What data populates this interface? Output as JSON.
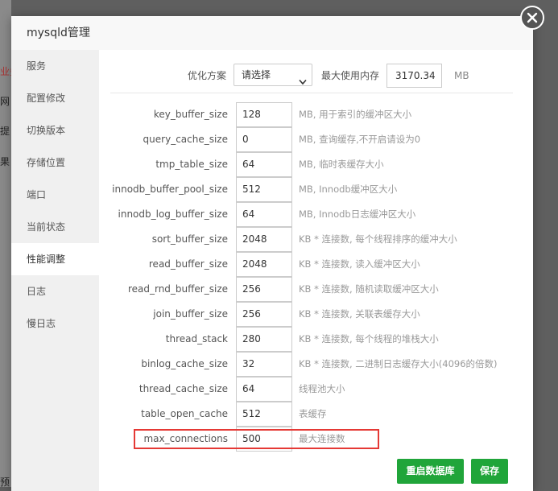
{
  "background": {
    "fragments": [
      "业务",
      "网",
      "提",
      "果",
      "预"
    ]
  },
  "dialog": {
    "title": "mysqld管理",
    "close_icon": "close-icon"
  },
  "sidebar": {
    "items": [
      {
        "label": "服务",
        "active": false
      },
      {
        "label": "配置修改",
        "active": false
      },
      {
        "label": "切换版本",
        "active": false
      },
      {
        "label": "存储位置",
        "active": false
      },
      {
        "label": "端口",
        "active": false
      },
      {
        "label": "当前状态",
        "active": false
      },
      {
        "label": "性能调整",
        "active": true
      },
      {
        "label": "日志",
        "active": false
      },
      {
        "label": "慢日志",
        "active": false
      }
    ]
  },
  "optimize": {
    "label": "优化方案",
    "select_value": "请选择",
    "max_mem_label": "最大使用内存",
    "max_mem_value": "3170.34",
    "max_mem_unit": "MB"
  },
  "params": [
    {
      "name": "key_buffer_size",
      "value": "128",
      "desc": "MB, 用于索引的缓冲区大小"
    },
    {
      "name": "query_cache_size",
      "value": "0",
      "desc": "MB, 查询缓存,不开启请设为0"
    },
    {
      "name": "tmp_table_size",
      "value": "64",
      "desc": "MB, 临时表缓存大小"
    },
    {
      "name": "innodb_buffer_pool_size",
      "value": "512",
      "desc": "MB, Innodb缓冲区大小"
    },
    {
      "name": "innodb_log_buffer_size",
      "value": "64",
      "desc": "MB, Innodb日志缓冲区大小"
    },
    {
      "name": "sort_buffer_size",
      "value": "2048",
      "desc": "KB * 连接数, 每个线程排序的缓冲大小"
    },
    {
      "name": "read_buffer_size",
      "value": "2048",
      "desc": "KB * 连接数, 读入缓冲区大小"
    },
    {
      "name": "read_rnd_buffer_size",
      "value": "256",
      "desc": "KB * 连接数, 随机读取缓冲区大小"
    },
    {
      "name": "join_buffer_size",
      "value": "256",
      "desc": "KB * 连接数, 关联表缓存大小"
    },
    {
      "name": "thread_stack",
      "value": "280",
      "desc": "KB * 连接数, 每个线程的堆栈大小"
    },
    {
      "name": "binlog_cache_size",
      "value": "32",
      "desc": "KB * 连接数, 二进制日志缓存大小(4096的倍数)"
    },
    {
      "name": "thread_cache_size",
      "value": "64",
      "desc": "线程池大小"
    },
    {
      "name": "table_open_cache",
      "value": "512",
      "desc": "表缓存"
    },
    {
      "name": "max_connections",
      "value": "500",
      "desc": "最大连接数"
    }
  ],
  "buttons": {
    "restart": "重启数据库",
    "save": "保存"
  },
  "colors": {
    "accent_green": "#20a53a",
    "highlight_red": "#e53935"
  }
}
